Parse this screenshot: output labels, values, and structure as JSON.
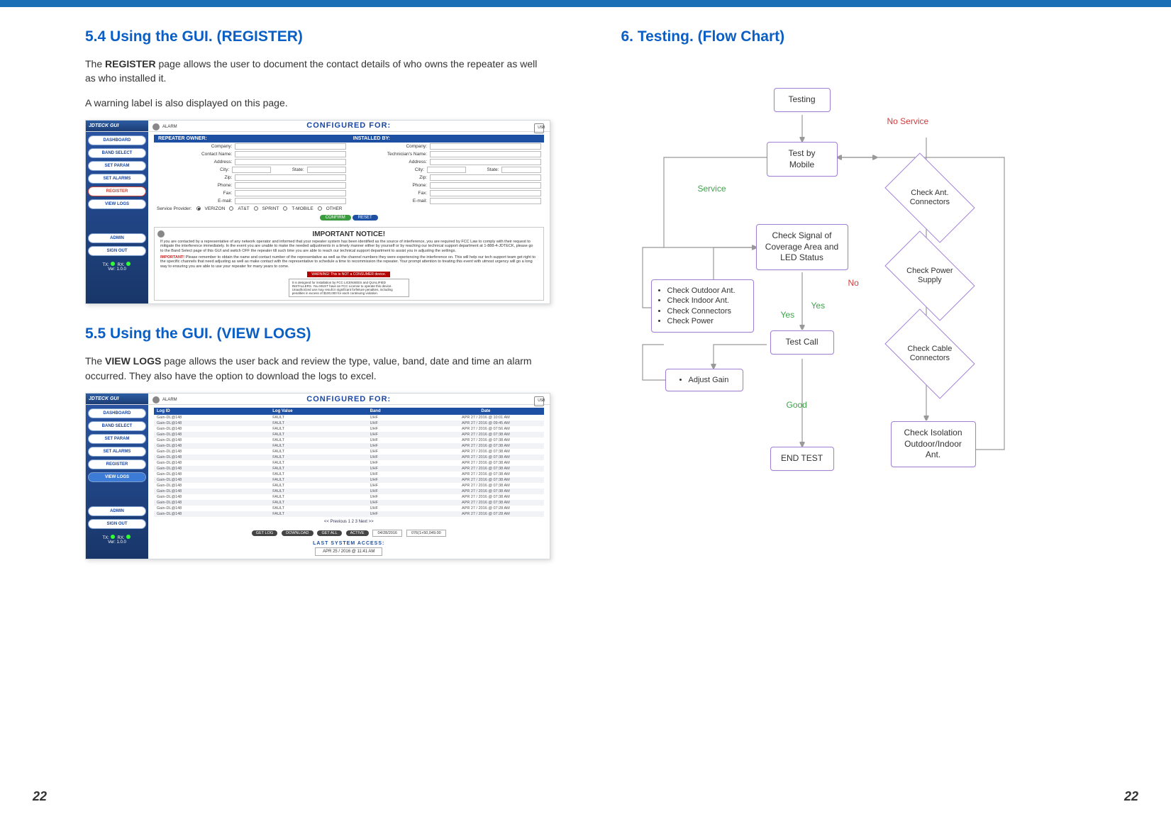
{
  "page_number": "22",
  "left": {
    "h1": "5.4 Using the GUI. (REGISTER)",
    "p1a": "The ",
    "p1b": "REGISTER",
    "p1c": " page allows the user to document the contact details of who owns the repeater as well as who installed it.",
    "p2": "A warning label is also displayed on this page.",
    "h2": "5.5 Using the GUI. (VIEW LOGS)",
    "p3a": "The ",
    "p3b": "VIEW LOGS",
    "p3c": " page allows the user back and review the type, value, band, date and time an alarm occurred. They also have the option to download the logs to excel."
  },
  "right": {
    "h1": "6. Testing. (Flow Chart)"
  },
  "gui": {
    "logo": "JDTECK GUI",
    "configured_for": "CONFIGURED FOR:",
    "usb_label": "USB",
    "alarm_label": "ALARM",
    "sidebar": {
      "dashboard": "DASHBOARD",
      "band_select": "BAND SELECT",
      "set_param": "SET PARAM",
      "set_alarms": "SET ALARMS",
      "register": "REGISTER",
      "view_logs": "VIEW LOGS",
      "admin": "ADMIN",
      "sign_out": "SIGN OUT",
      "tx": "TX:",
      "rx": "RX:",
      "ver": "Ver: 1.0.0"
    },
    "register": {
      "owner_head": "REPEATER OWNER:",
      "installed_head": "INSTALLED BY:",
      "labels": {
        "company": "Company:",
        "contact": "Contact Name:",
        "tech": "Technician's Name:",
        "address": "Address:",
        "city": "City:",
        "state": "State:",
        "zip": "Zip:",
        "phone": "Phone:",
        "fax": "Fax:",
        "email": "E-mail:",
        "service_provider": "Service Provider:"
      },
      "providers": [
        "VERIZON",
        "AT&T",
        "SPRINT",
        "T-MOBILE",
        "OTHER"
      ],
      "confirm": "CONFIRM",
      "reset": "RESET",
      "notice_title": "IMPORTANT NOTICE!",
      "notice_body_1": "If you are contacted by a representative of any network operator and informed that your repeater system has been identified as the source of interference, you are required by FCC Law to comply with their request to mitigate the interference immediately. In the event you are unable to make the needed adjustments in a timely manner either by yourself or by reaching our technical support department at 1-888-4-JDTECK, please go to the Band Select page of this GUI and switch OFF the repeater till such time you are able to reach our technical support department to assist you in adjusting the settings.",
      "notice_body_2a": "IMPORTANT!",
      "notice_body_2b": " Please remember to obtain the name and contact number of the representative as well as the channel numbers they were experiencing the interference on. This will help our tech support team get right to the specific channels that need adjusting as well as make contact with the representative to schedule a time to recommission the repeater. Your prompt attention to treating this event with utmost urgency will go a long way to ensuring you are able to use your repeater for many years to come.",
      "warn_banner": "WARNING! This is NOT a CONSUMER device.",
      "warn_small": "It is designed for installation by FCC LICENSEES and QUALIFIED INSTALLERS. You MUST have an FCC License to operate this device. Unauthorized use may result in significant forfeiture penalties, including penalties in excess of $100,000 for each continuing violation."
    },
    "logs": {
      "headers": {
        "id": "Log ID",
        "value": "Log Value",
        "band": "Band",
        "date": "Date"
      },
      "rows": [
        {
          "id": "Gain-DL@148",
          "val": "FAULT",
          "band": "UHF",
          "date": "APR 27 / 2016 @ 10:01 AM"
        },
        {
          "id": "Gain-DL@148",
          "val": "FAULT",
          "band": "UHF",
          "date": "APR 27 / 2016 @ 09:45 AM"
        },
        {
          "id": "Gain-DL@148",
          "val": "FAULT",
          "band": "UHF",
          "date": "APR 27 / 2016 @ 07:56 AM"
        },
        {
          "id": "Gain-DL@148",
          "val": "FAULT",
          "band": "UHF",
          "date": "APR 27 / 2016 @ 07:38 AM"
        },
        {
          "id": "Gain-DL@148",
          "val": "FAULT",
          "band": "UHF",
          "date": "APR 27 / 2016 @ 07:38 AM"
        },
        {
          "id": "Gain-DL@148",
          "val": "FAULT",
          "band": "UHF",
          "date": "APR 27 / 2016 @ 07:38 AM"
        },
        {
          "id": "Gain-DL@148",
          "val": "FAULT",
          "band": "UHF",
          "date": "APR 27 / 2016 @ 07:38 AM"
        },
        {
          "id": "Gain-DL@148",
          "val": "FAULT",
          "band": "UHF",
          "date": "APR 27 / 2016 @ 07:38 AM"
        },
        {
          "id": "Gain-DL@148",
          "val": "FAULT",
          "band": "UHF",
          "date": "APR 27 / 2016 @ 07:38 AM"
        },
        {
          "id": "Gain-DL@148",
          "val": "FAULT",
          "band": "UHF",
          "date": "APR 27 / 2016 @ 07:38 AM"
        },
        {
          "id": "Gain-DL@148",
          "val": "FAULT",
          "band": "UHF",
          "date": "APR 27 / 2016 @ 07:38 AM"
        },
        {
          "id": "Gain-DL@148",
          "val": "FAULT",
          "band": "UHF",
          "date": "APR 27 / 2016 @ 07:38 AM"
        },
        {
          "id": "Gain-DL@148",
          "val": "FAULT",
          "band": "UHF",
          "date": "APR 27 / 2016 @ 07:38 AM"
        },
        {
          "id": "Gain-DL@148",
          "val": "FAULT",
          "band": "UHF",
          "date": "APR 27 / 2016 @ 07:38 AM"
        },
        {
          "id": "Gain-DL@148",
          "val": "FAULT",
          "band": "UHF",
          "date": "APR 27 / 2016 @ 07:38 AM"
        },
        {
          "id": "Gain-DL@148",
          "val": "FAULT",
          "band": "UHF",
          "date": "APR 27 / 2016 @ 07:38 AM"
        },
        {
          "id": "Gain-DL@148",
          "val": "FAULT",
          "band": "UHF",
          "date": "APR 27 / 2016 @ 07:28 AM"
        },
        {
          "id": "Gain-DL@148",
          "val": "FAULT",
          "band": "UHF",
          "date": "APR 27 / 2016 @ 07:28 AM"
        }
      ],
      "pager": "<< Previous   1   2   3   Next >>",
      "chip_getlog": "GET LOG",
      "chip_download": "DOWNLOAD",
      "chip_getall": "GET ALL",
      "chip_active": "ACTIVE",
      "field_date": "04/28/2016",
      "field_count": "076(1+50,049.00",
      "last_access": "LAST SYSTEM ACCESS:",
      "last_access_val": "APR 25 / 2016 @ 11:41 AM"
    }
  },
  "flow": {
    "testing": "Testing",
    "test_by_mobile": "Test by Mobile",
    "no_service": "No Service",
    "service": "Service",
    "check_ant_connectors": "Check Ant. Connectors",
    "check_signal": "Check Signal of Coverage Area and LED Status",
    "check_power_supply": "Check Power Supply",
    "checklist": [
      "Check Outdoor Ant.",
      "Check Indoor Ant.",
      "Check Connectors",
      "Check Power"
    ],
    "no": "No",
    "yes": "Yes",
    "test_call": "Test Call",
    "check_cable_connectors": "Check Cable Connectors",
    "adjust_gain": "Adjust Gain",
    "good": "Good",
    "check_isolation": "Check Isolation Outdoor/Indoor Ant.",
    "end_test": "END TEST"
  }
}
